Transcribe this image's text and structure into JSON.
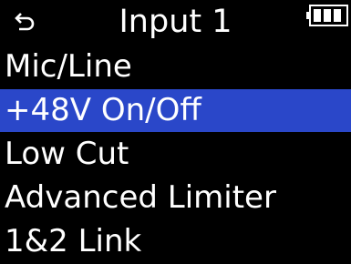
{
  "header": {
    "title": "Input 1",
    "back_icon": "return-arrow-icon",
    "battery_icon": "battery-icon"
  },
  "menu": {
    "items": [
      {
        "label": "Mic/Line",
        "selected": false
      },
      {
        "label": "+48V On/Off",
        "selected": true
      },
      {
        "label": "Low Cut",
        "selected": false
      },
      {
        "label": "Advanced Limiter",
        "selected": false
      },
      {
        "label": "1&2 Link",
        "selected": false
      }
    ]
  },
  "colors": {
    "background": "#000000",
    "text": "#ffffff",
    "highlight": "#2a47c9"
  }
}
